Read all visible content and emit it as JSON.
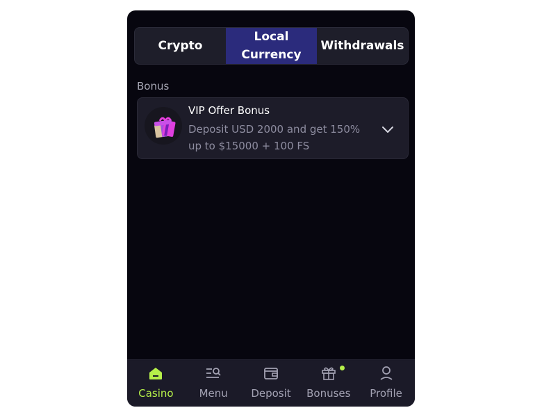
{
  "tabs": [
    {
      "label": "Crypto",
      "active": false
    },
    {
      "label": "Local Currency",
      "active": true
    },
    {
      "label": "Withdrawals",
      "active": false
    }
  ],
  "bonus_section": {
    "label": "Bonus",
    "selected": {
      "title": "VIP Offer Bonus",
      "description": "Deposit USD 2000 and get 150% up to $15000 + 100 FS",
      "icon": "gift-icon"
    }
  },
  "bottom_nav": [
    {
      "label": "Casino",
      "icon": "home-icon",
      "active": true
    },
    {
      "label": "Menu",
      "icon": "menu-search-icon",
      "active": false
    },
    {
      "label": "Deposit",
      "icon": "wallet-icon",
      "active": false
    },
    {
      "label": "Bonuses",
      "icon": "gift-icon",
      "active": false,
      "notification": true
    },
    {
      "label": "Profile",
      "icon": "user-icon",
      "active": false
    }
  ],
  "colors": {
    "background": "#07060f",
    "card": "#1d1c29",
    "active_tab": "#2b2b7c",
    "accent": "#b6f04a",
    "muted_text": "#8e8da0"
  }
}
